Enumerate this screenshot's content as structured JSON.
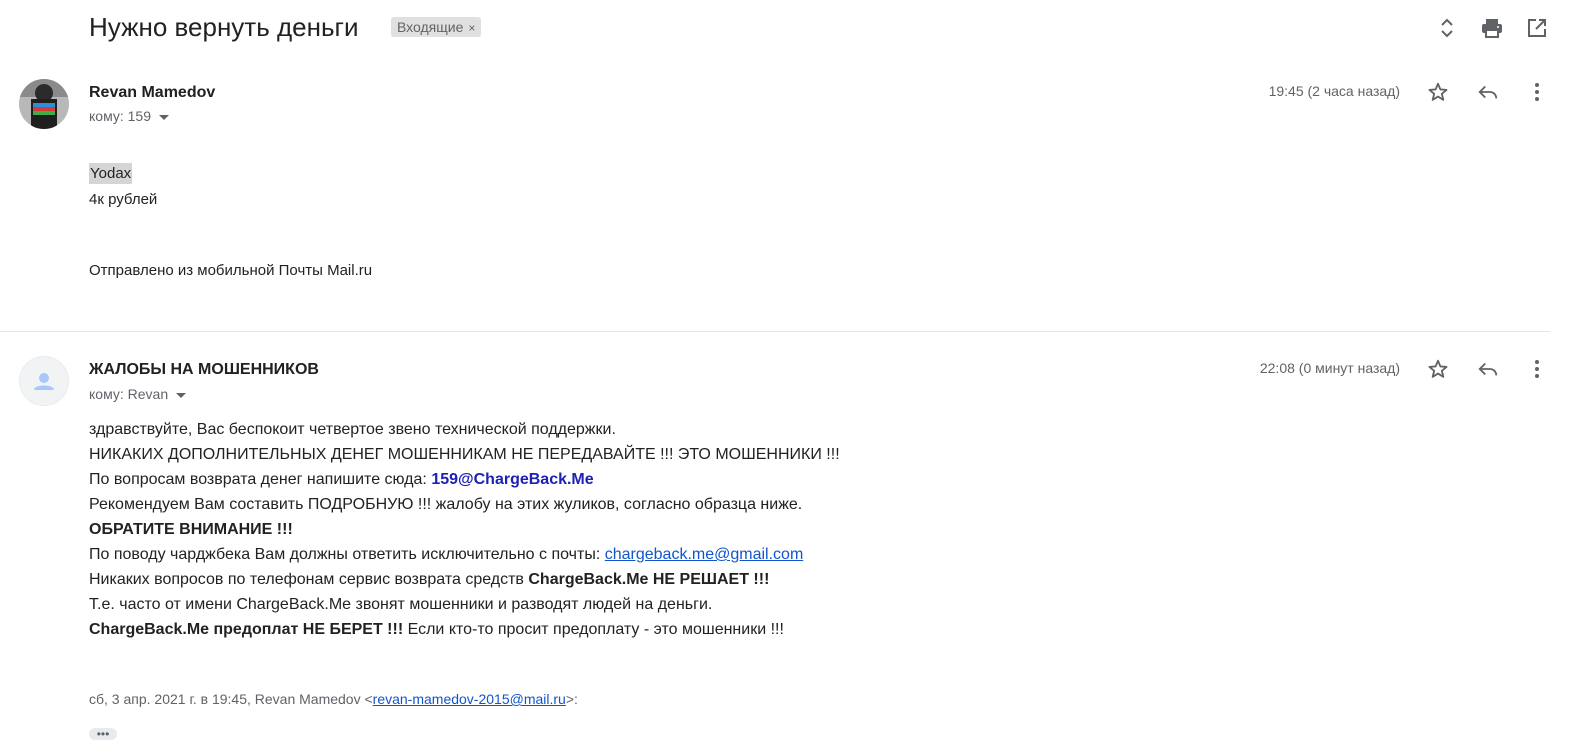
{
  "header": {
    "subject": "Нужно вернуть деньги",
    "label": "Входящие",
    "label_close": "×",
    "icons": [
      "expand-collapse-icon",
      "print-icon",
      "open-in-new-window-icon"
    ]
  },
  "message1": {
    "sender": "Revan Mamedov",
    "to": "кому: 159",
    "time": "19:45 (2 часа назад)",
    "body": {
      "line1": "Yodax",
      "line2": "4к рублей",
      "signature": "Отправлено из мобильной Почты Mail.ru"
    }
  },
  "message2": {
    "sender": "ЖАЛОБЫ НА МОШЕННИКОВ",
    "to": "кому: Revan",
    "time": "22:08 (0 минут назад)",
    "lines": {
      "l1": "здравствуйте, Вас беспокоит четвертое звено технической поддержки.",
      "l2": "НИКАКИХ ДОПОЛНИТЕЛЬНЫХ ДЕНЕГ МОШЕННИКАМ НЕ ПЕРЕДАВАЙТЕ !!! ЭТО МОШЕННИКИ !!!",
      "l3_prefix": "По вопросам возврата денег напишите сюда: ",
      "l3_email": "159@ChargeBack.Me",
      "l4": "Рекомендуем Вам составить ПОДРОБНУЮ !!! жалобу на этих жуликов, согласно образца ниже.",
      "l5": "ОБРАТИТЕ ВНИМАНИЕ !!!",
      "l6_prefix": "По поводу чарджбека Вам должны ответить исключительно с почты: ",
      "l6_email": "chargeback.me@gmail.com",
      "l7_prefix": "Никаких вопросов по телефонам сервис возврата средств ",
      "l7_bold": "ChargeBack.Me НЕ РЕШАЕТ !!!",
      "l8": "Т.е. часто от имени ChargeBack.Me звонят мошенники и разводят людей на деньги.",
      "l9_bold": "ChargeBack.Me предоплат НЕ БЕРЕТ !!!",
      "l9_suffix": " Если кто-то просит предоплату - это мошенники !!!"
    },
    "quote": {
      "prefix": "сб, 3 апр. 2021 г. в 19:45, Revan Mamedov <",
      "email": "revan-mamedov-2015@mail.ru",
      "suffix": ">:"
    },
    "show_trimmed": "•••"
  },
  "colors": {
    "link": "#1155cc",
    "email_bold": "#1d21b5",
    "secondary_text": "#5f6368",
    "label_bg": "#e0e0e0"
  }
}
